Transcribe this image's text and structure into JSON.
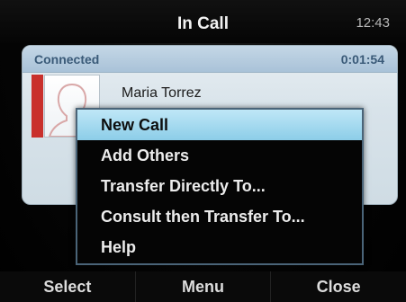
{
  "header": {
    "title": "In Call",
    "time": "12:43"
  },
  "call": {
    "status": "Connected",
    "duration": "0:01:54",
    "contact_name": "Maria Torrez",
    "status_color": "#c9302c"
  },
  "menu": {
    "items": [
      {
        "label": "New Call",
        "selected": true
      },
      {
        "label": "Add Others",
        "selected": false
      },
      {
        "label": "Transfer Directly To...",
        "selected": false
      },
      {
        "label": "Consult then Transfer To...",
        "selected": false
      },
      {
        "label": "Help",
        "selected": false
      }
    ]
  },
  "softkeys": {
    "left": "Select",
    "center": "Menu",
    "right": "Close"
  },
  "icons": {
    "avatar": "person-silhouette-icon"
  }
}
